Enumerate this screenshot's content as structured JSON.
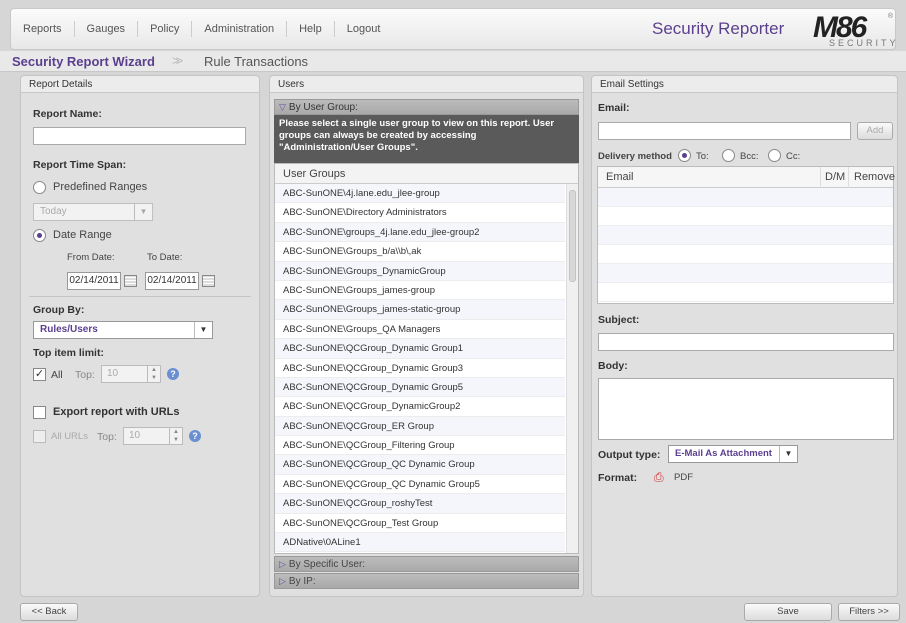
{
  "nav": [
    "Reports",
    "Gauges",
    "Policy",
    "Administration",
    "Help",
    "Logout"
  ],
  "app_title": "Security Reporter",
  "logo": {
    "main": "M86",
    "sub": "SECURITY",
    "reg": "®"
  },
  "breadcrumb": {
    "wizard": "Security Report Wizard",
    "separator": ">>",
    "current": "Rule Transactions"
  },
  "left": {
    "title": "Report Details",
    "report_name_label": "Report Name:",
    "report_name_value": "",
    "timespan_label": "Report Time Span:",
    "predefined_label": "Predefined Ranges",
    "predefined_value": "Today",
    "date_range_label": "Date Range",
    "from_label": "From Date:",
    "to_label": "To Date:",
    "from_value": "02/14/2011",
    "to_value": "02/14/2011",
    "group_by_label": "Group By:",
    "group_by_value": "Rules/Users",
    "top_limit_label": "Top item limit:",
    "all_label": "All",
    "top_label": "Top:",
    "top_value": "10",
    "export_label": "Export report with URLs",
    "all_urls_label": "All URLs",
    "top2_label": "Top:",
    "top2_value": "10"
  },
  "middle": {
    "title": "Users",
    "by_group": "By User Group:",
    "info": "Please select a single user group to view on this report. User groups can always be created by accessing \"Administration/User Groups\".",
    "list_header": "User Groups",
    "groups": [
      "ABC-SunONE\\4j.lane.edu_jlee-group",
      "ABC-SunONE\\Directory Administrators",
      "ABC-SunONE\\groups_4j.lane.edu_jlee-group2",
      "ABC-SunONE\\Groups_b/a\\\\b\\,ak",
      "ABC-SunONE\\Groups_DynamicGroup",
      "ABC-SunONE\\Groups_james-group",
      "ABC-SunONE\\Groups_james-static-group",
      "ABC-SunONE\\Groups_QA Managers",
      "ABC-SunONE\\QCGroup_Dynamic Group1",
      "ABC-SunONE\\QCGroup_Dynamic Group3",
      "ABC-SunONE\\QCGroup_Dynamic Group5",
      "ABC-SunONE\\QCGroup_DynamicGroup2",
      "ABC-SunONE\\QCGroup_ER Group",
      "ABC-SunONE\\QCGroup_Filtering Group",
      "ABC-SunONE\\QCGroup_QC Dynamic Group",
      "ABC-SunONE\\QCGroup_QC Dynamic Group5",
      "ABC-SunONE\\QCGroup_roshyTest",
      "ABC-SunONE\\QCGroup_Test Group",
      "ADNative\\0ALine1"
    ],
    "by_user": "By Specific User:",
    "by_ip": "By IP:"
  },
  "right": {
    "title": "Email Settings",
    "email_label": "Email:",
    "email_value": "",
    "add_button": "Add",
    "delivery_label": "Delivery method",
    "to_label": "To:",
    "bcc_label": "Bcc:",
    "cc_label": "Cc:",
    "col_email": "Email",
    "col_dm": "D/M",
    "col_remove": "Remove",
    "subject_label": "Subject:",
    "body_label": "Body:",
    "output_label": "Output type:",
    "output_value": "E-Mail As Attachment",
    "format_label": "Format:",
    "format_value": "PDF"
  },
  "footer": {
    "back": "<< Back",
    "save": "Save",
    "filters": "Filters >>"
  },
  "colors": {
    "accent": "#5b3f8f",
    "info_bg": "#5a5a5a",
    "panel_bg": "#e0e0e0"
  }
}
